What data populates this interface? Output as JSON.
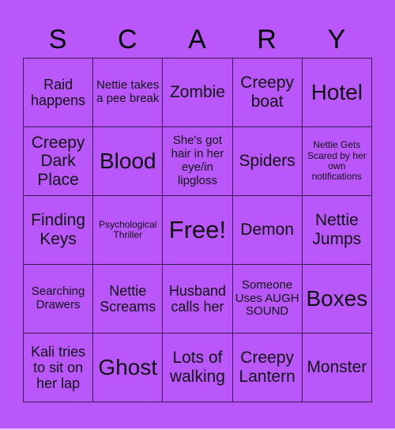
{
  "title_letters": [
    "S",
    "C",
    "A",
    "R",
    "Y"
  ],
  "board": [
    [
      "Raid happens",
      "Nettie takes a pee break",
      "Zombie",
      "Creepy boat",
      "Hotel"
    ],
    [
      "Creepy Dark Place",
      "Blood",
      "She's got hair in her eye/in lipgloss",
      "Spiders",
      "Nettie Gets Scared by her own notifications"
    ],
    [
      "Finding Keys",
      "Psychological Thriller",
      "Free!",
      "Demon",
      "Nettie Jumps"
    ],
    [
      "Searching Drawers",
      "Nettie Screams",
      "Husband calls her",
      "Someone Uses AUGH SOUND",
      "Boxes"
    ],
    [
      "Kali tries to sit on her lap",
      "Ghost",
      "Lots of walking",
      "Creepy Lantern",
      "Monster"
    ]
  ],
  "colors": {
    "background": "#b957fb",
    "grid_line": "#3a1a4e",
    "text": "#000000"
  }
}
